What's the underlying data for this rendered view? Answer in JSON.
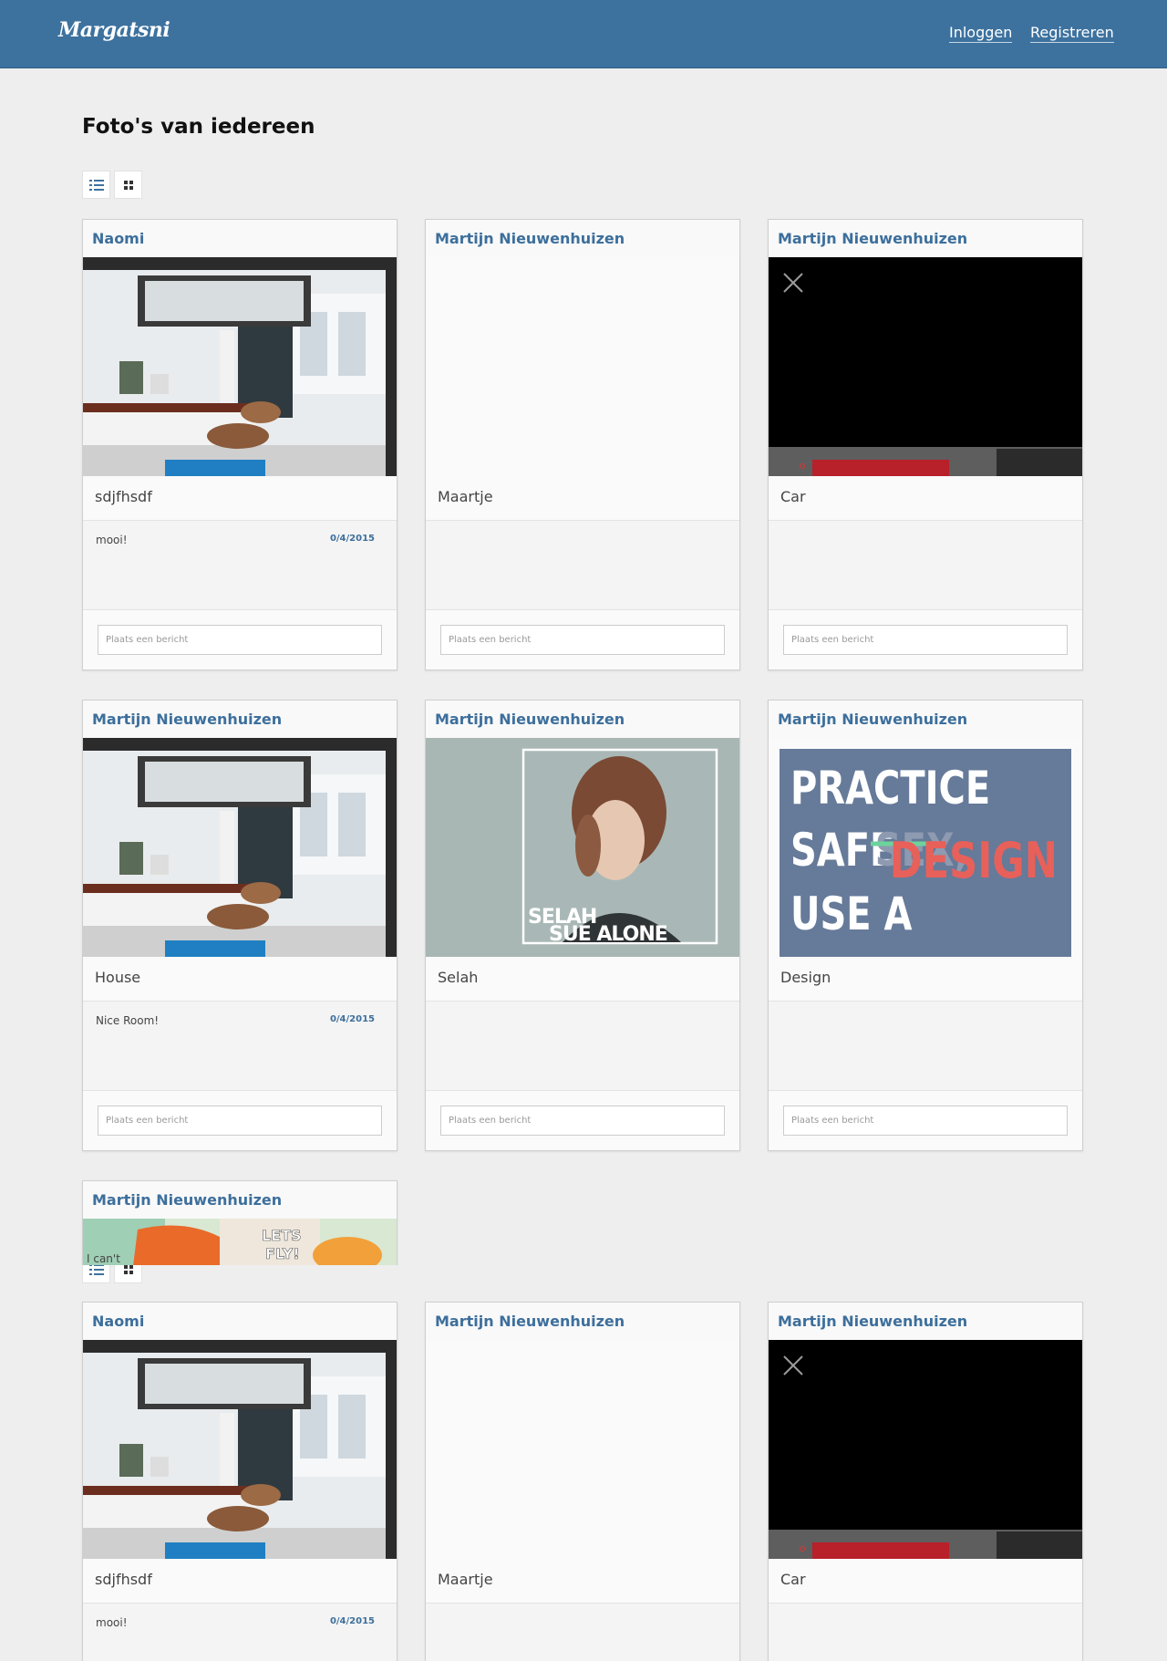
{
  "app": {
    "brand": "Margatsni"
  },
  "nav": {
    "login": "Inloggen",
    "register": "Registreren"
  },
  "page": {
    "title": "Foto's van iedereen"
  },
  "view_toggle": {
    "list_icon": "list-view-icon",
    "grid_icon": "grid-view-icon"
  },
  "comment_placeholder": "Plaats een bericht",
  "posts": [
    {
      "author": "Naomi",
      "title": "sdjfhsdf",
      "image": "interior-loft-photo",
      "comment": "mooi!",
      "date": "0/4/2015"
    },
    {
      "author": "Martijn Nieuwenhuizen",
      "title": "Maartje",
      "image": "blank-image"
    },
    {
      "author": "Martijn Nieuwenhuizen",
      "title": "Car",
      "image": "video-with-close-icon"
    },
    {
      "author": "Martijn Nieuwenhuizen",
      "title": "House",
      "image": "interior-loft-photo",
      "comment": "Nice Room!",
      "date": "0/4/2015"
    },
    {
      "author": "Martijn Nieuwenhuizen",
      "title": "Selah",
      "image": "selah-sue-album-cover",
      "cover_text": [
        "SELAH",
        "SUE ALONE"
      ]
    },
    {
      "author": "Martijn Nieuwenhuizen",
      "title": "Design",
      "image": "practice-safe-design-poster",
      "poster_text": [
        "PRACTICE",
        "SAFE",
        "SEX,",
        "DESIGN",
        "USE A"
      ]
    },
    {
      "author": "Martijn Nieuwenhuizen",
      "image": "colorful-illustration",
      "illustration_text": [
        "LETS",
        "FLY!",
        "I can't"
      ]
    }
  ],
  "colors": {
    "navbar": "#3d729f",
    "author_link": "#3d6f9c",
    "page_bg": "#eeeeee",
    "poster_bg": "#667a99",
    "poster_accent": "#e8605a"
  }
}
